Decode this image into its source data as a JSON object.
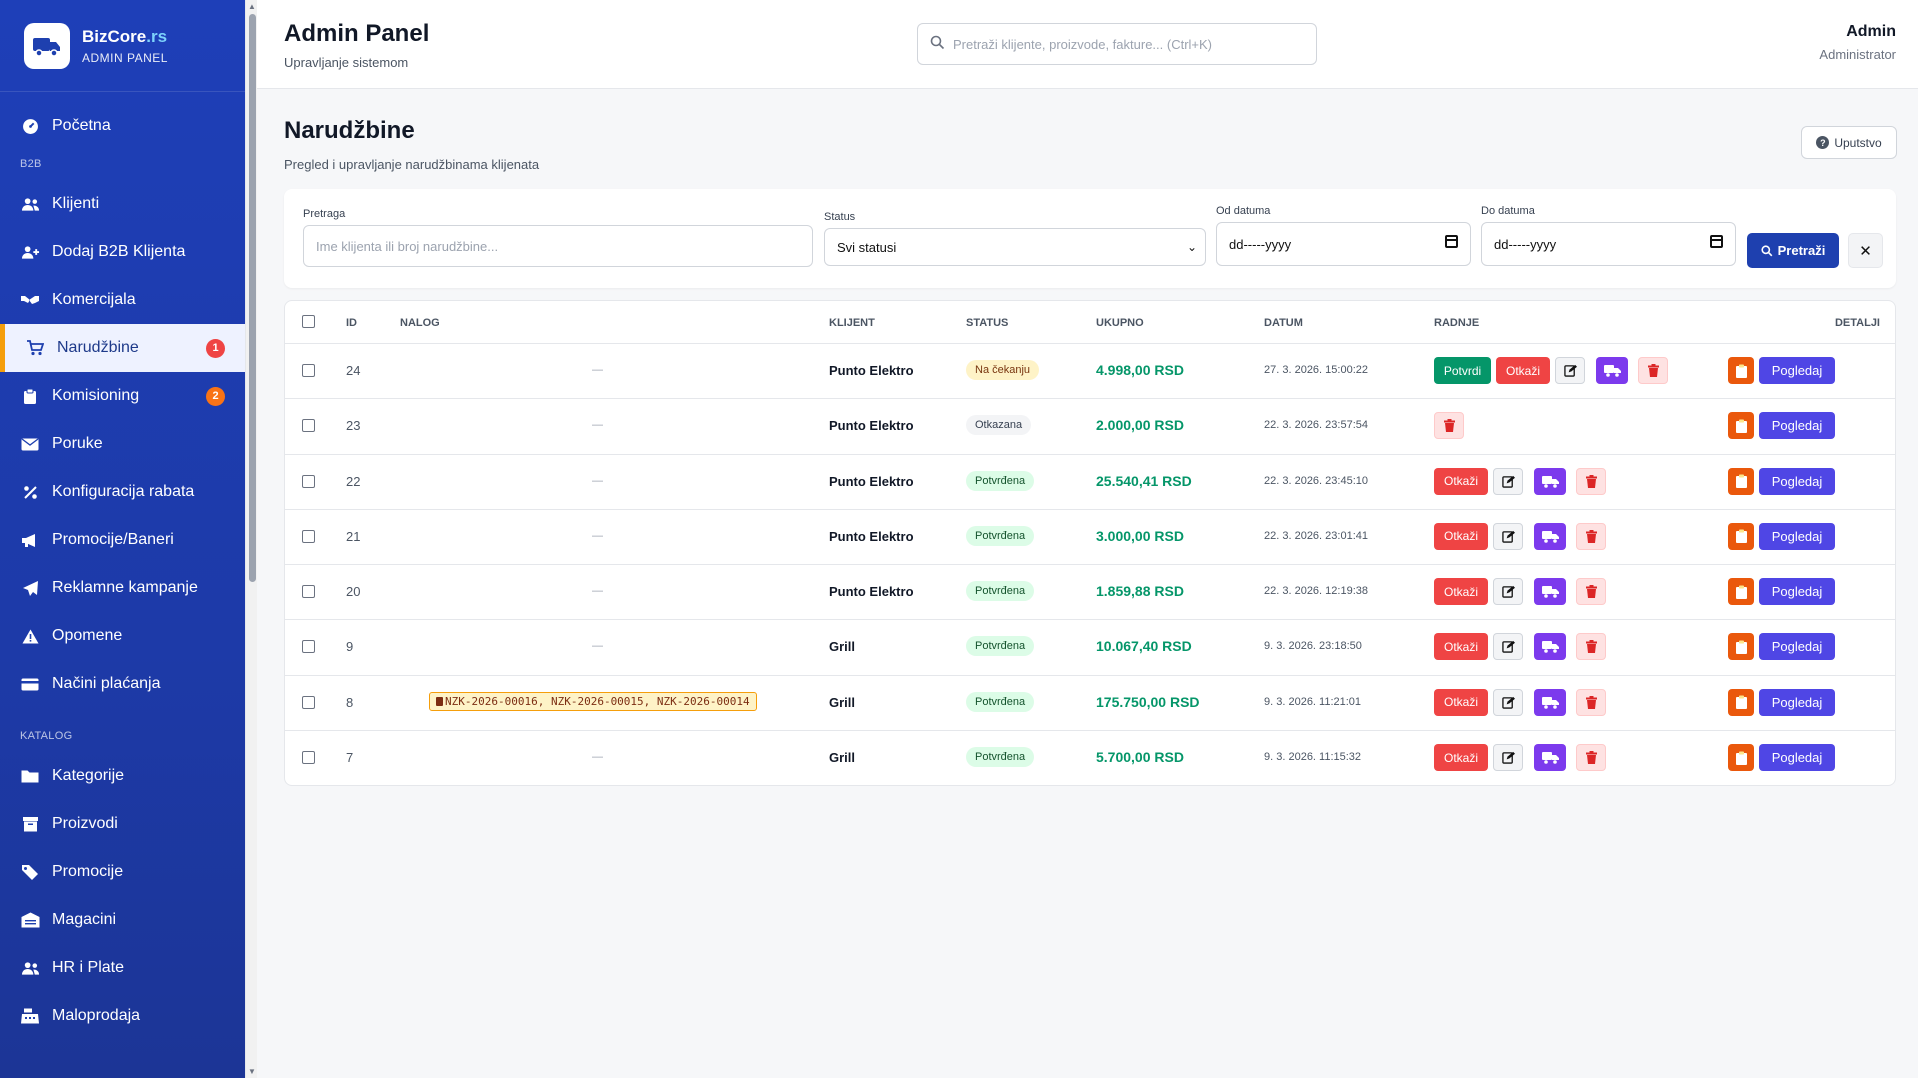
{
  "brand": {
    "name": "BizCore",
    "tld": ".rs",
    "sub": "ADMIN PANEL"
  },
  "nav": {
    "items_top": [
      {
        "label": "Početna",
        "icon": "dashboard-icon"
      }
    ],
    "section_b2b": "B2B",
    "items_b2b": [
      {
        "label": "Klijenti",
        "icon": "users-icon"
      },
      {
        "label": "Dodaj B2B Klijenta",
        "icon": "user-plus-icon"
      },
      {
        "label": "Komercijala",
        "icon": "handshake-icon"
      },
      {
        "label": "Narudžbine",
        "icon": "cart-icon",
        "badge": "1",
        "badge_color": "#ef4444",
        "active": true
      },
      {
        "label": "Komisioning",
        "icon": "clipboard-icon",
        "badge": "2",
        "badge_color": "#f97316"
      },
      {
        "label": "Poruke",
        "icon": "envelope-icon"
      },
      {
        "label": "Konfiguracija rabata",
        "icon": "percent-icon"
      },
      {
        "label": "Promocije/Baneri",
        "icon": "bullhorn-icon"
      },
      {
        "label": "Reklamne kampanje",
        "icon": "paper-plane-icon"
      },
      {
        "label": "Opomene",
        "icon": "warning-icon"
      },
      {
        "label": "Načini plaćanja",
        "icon": "credit-card-icon"
      }
    ],
    "section_katalog": "KATALOG",
    "items_katalog": [
      {
        "label": "Kategorije",
        "icon": "folder-icon"
      },
      {
        "label": "Proizvodi",
        "icon": "box-icon"
      },
      {
        "label": "Promocije",
        "icon": "tags-icon"
      },
      {
        "label": "Magacini",
        "icon": "warehouse-icon"
      },
      {
        "label": "HR i Plate",
        "icon": "users-icon"
      },
      {
        "label": "Maloprodaja",
        "icon": "cash-register-icon"
      }
    ]
  },
  "topbar": {
    "title": "Admin Panel",
    "subtitle": "Upravljanje sistemom",
    "search_placeholder": "Pretraži klijente, proizvode, fakture... (Ctrl+K)",
    "user_name": "Admin",
    "user_role": "Administrator"
  },
  "page": {
    "title": "Narudžbine",
    "description": "Pregled i upravljanje narudžbinama klijenata",
    "help_label": "Uputstvo"
  },
  "filters": {
    "search_label": "Pretraga",
    "search_placeholder": "Ime klijenta ili broj narudžbine...",
    "status_label": "Status",
    "status_value": "Svi statusi",
    "from_label": "Od datuma",
    "from_value": "dd-----yyyy",
    "to_label": "Do datuma",
    "to_value": "dd-----yyyy",
    "search_button": "Pretraži",
    "clear_button": "✕"
  },
  "table": {
    "headers": {
      "id": "ID",
      "nalog": "NALOG",
      "klijent": "KLIJENT",
      "status": "STATUS",
      "ukupno": "UKUPNO",
      "datum": "DATUM",
      "radnje": "RADNJE",
      "detalji": "DETALJI"
    },
    "action_labels": {
      "confirm": "Potvrdi",
      "cancel": "Otkaži",
      "view": "Pogledaj"
    },
    "rows": [
      {
        "id": "24",
        "nalog": "—",
        "client": "Punto Elektro",
        "status": "Na čekanju",
        "status_type": "pending",
        "total": "4.998,00 RSD",
        "date": "27. 3. 2026. 15:00:22"
      },
      {
        "id": "23",
        "nalog": "—",
        "client": "Punto Elektro",
        "status": "Otkazana",
        "status_type": "cancel",
        "total": "2.000,00 RSD",
        "date": "22. 3. 2026. 23:57:54"
      },
      {
        "id": "22",
        "nalog": "—",
        "client": "Punto Elektro",
        "status": "Potvrđena",
        "status_type": "ok",
        "total": "25.540,41 RSD",
        "date": "22. 3. 2026. 23:45:10"
      },
      {
        "id": "21",
        "nalog": "—",
        "client": "Punto Elektro",
        "status": "Potvrđena",
        "status_type": "ok",
        "total": "3.000,00 RSD",
        "date": "22. 3. 2026. 23:01:41"
      },
      {
        "id": "20",
        "nalog": "—",
        "client": "Punto Elektro",
        "status": "Potvrđena",
        "status_type": "ok",
        "total": "1.859,88 RSD",
        "date": "22. 3. 2026. 12:19:38"
      },
      {
        "id": "9",
        "nalog": "—",
        "client": "Grill",
        "status": "Potvrđena",
        "status_type": "ok",
        "total": "10.067,40 RSD",
        "date": "9. 3. 2026. 23:18:50"
      },
      {
        "id": "8",
        "nalog": "NZK-2026-00016, NZK-2026-00015, NZK-2026-00014",
        "client": "Grill",
        "status": "Potvrđena",
        "status_type": "ok",
        "total": "175.750,00 RSD",
        "date": "9. 3. 2026. 11:21:01"
      },
      {
        "id": "7",
        "nalog": "—",
        "client": "Grill",
        "status": "Potvrđena",
        "status_type": "ok",
        "total": "5.700,00 RSD",
        "date": "9. 3. 2026. 11:15:32"
      }
    ]
  }
}
